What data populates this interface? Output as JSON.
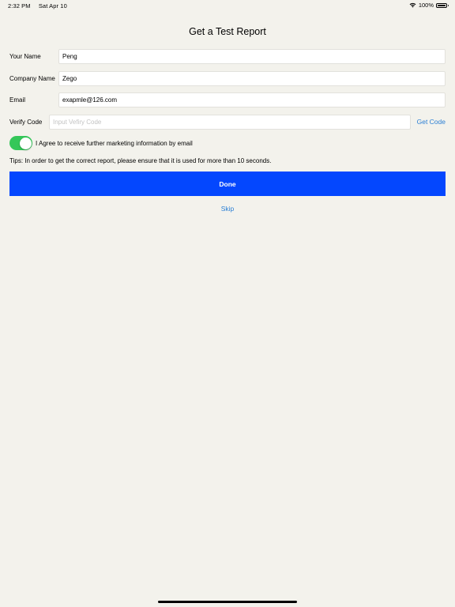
{
  "status_bar": {
    "time": "2:32 PM",
    "date": "Sat Apr 10",
    "battery": "100%"
  },
  "title": "Get a Test Report",
  "form": {
    "name": {
      "label": "Your Name",
      "value": "Peng"
    },
    "company": {
      "label": "Company Name",
      "value": "Zego"
    },
    "email": {
      "label": "Email",
      "value": "exapmle@126.com"
    },
    "verify": {
      "label": "Verify Code",
      "value": "",
      "placeholder": "Input Vefiry Code",
      "action": "Get Code"
    }
  },
  "agree": {
    "enabled": true,
    "text": "I Agree to receive further marketing information by email"
  },
  "tips": "Tips: In order to get the correct report, please ensure that it is used for more than 10 seconds.",
  "done_label": "Done",
  "skip_label": "Skip",
  "colors": {
    "background": "#f3f2ec",
    "accent_blue": "#0447fe",
    "link_blue": "#2a7fd4",
    "toggle_green": "#34c759"
  }
}
